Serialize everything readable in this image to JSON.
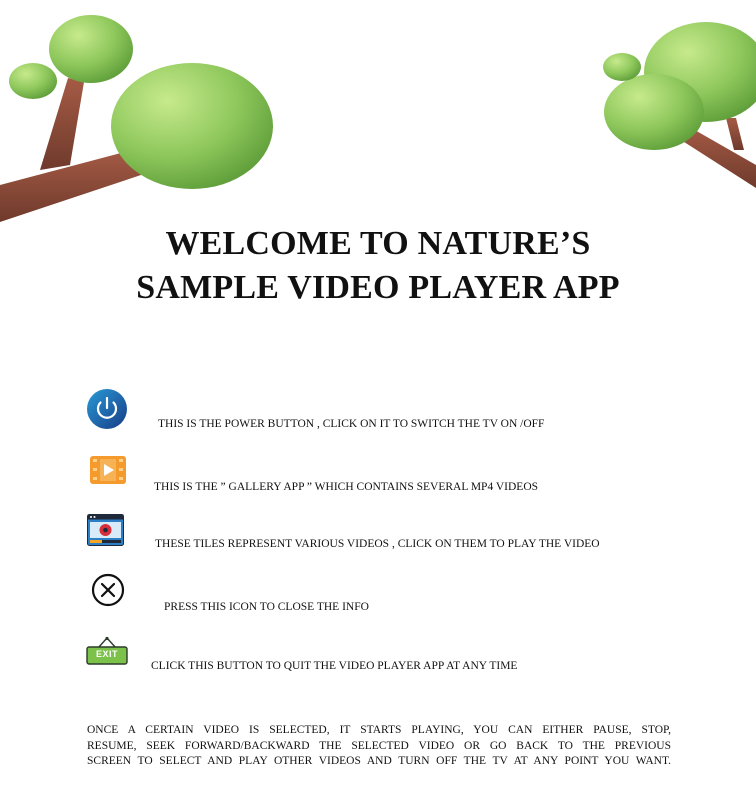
{
  "title": {
    "line1": "WELCOME TO NATURE’S",
    "line2": "SAMPLE VIDEO PLAYER APP"
  },
  "info_items": [
    {
      "icon": "power-icon",
      "text": "THIS IS THE POWER BUTTON , CLICK ON IT TO SWITCH THE TV ON /OFF"
    },
    {
      "icon": "gallery-app-icon",
      "text": "THIS IS THE ” GALLERY APP ” WHICH CONTAINS SEVERAL MP4 VIDEOS"
    },
    {
      "icon": "video-tile-icon",
      "text": "THESE TILES REPRESENT VARIOUS VIDEOS , CLICK ON THEM TO PLAY THE VIDEO"
    },
    {
      "icon": "close-icon",
      "text": "PRESS THIS ICON TO CLOSE THE INFO"
    },
    {
      "icon": "exit-sign-icon",
      "text": "CLICK THIS BUTTON TO QUIT THE VIDEO PLAYER APP AT ANY TIME",
      "sign_label": "EXIT"
    }
  ],
  "closing": {
    "line1": "ONCE A CERTAIN VIDEO IS SELECTED, IT STARTS PLAYING, YOU CAN EITHER PAUSE, STOP,",
    "line2": "RESUME, SEEK FORWARD/BACKWARD THE SELECTED VIDEO OR GO BACK TO THE PREVIOUS",
    "line3": "SCREEN TO SELECT AND PLAY OTHER VIDEOS AND TURN OFF THE TV AT ANY POINT YOU WANT."
  },
  "colors": {
    "text": "#111111",
    "leaf_green": "#8cc65a",
    "branch_brown": "#8a4a3a",
    "power_blue": "#1f5fa8",
    "gallery_orange": "#f59a2c",
    "exit_green": "#7cc24a"
  }
}
